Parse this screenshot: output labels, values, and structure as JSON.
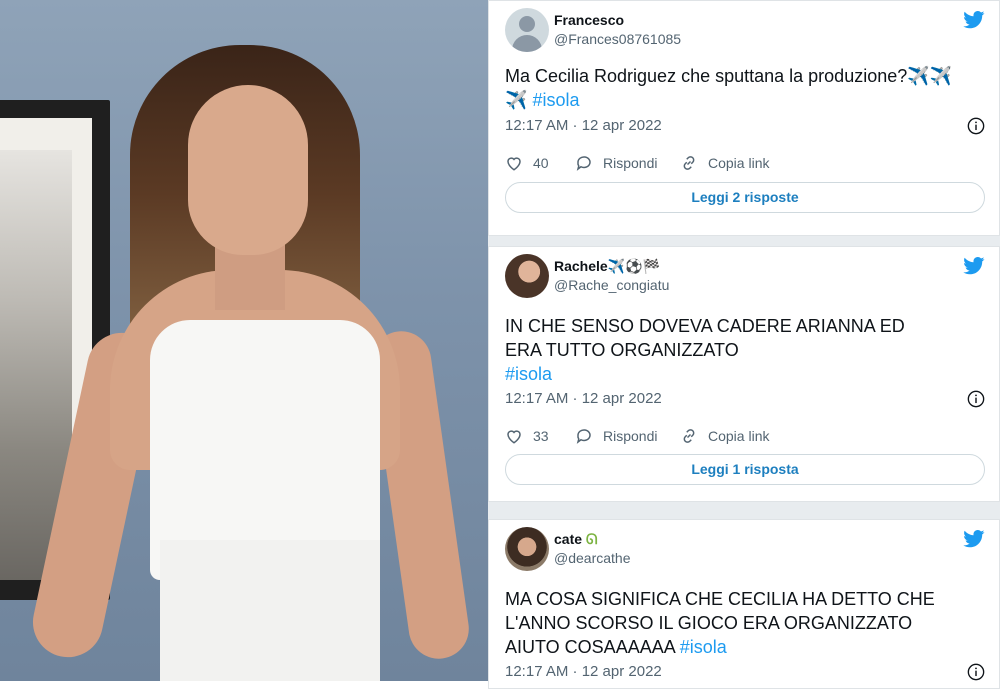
{
  "photo": {
    "description_icon": "photo"
  },
  "tweets": [
    {
      "name": "Francesco",
      "handle": "@Frances08761085",
      "text_main": "Ma Cecilia Rodriguez che sputtana la produzione?✈️✈️ ✈️",
      "text_hashtag": "#isola",
      "time": "12:17 AM · 12 apr 2022",
      "likes": "40",
      "reply_label": "Rispondi",
      "copy_label": "Copia link",
      "replies_button": "Leggi 2 risposte"
    },
    {
      "name": "Rachele✈️⚽️🏁",
      "handle": "@Rache_congiatu",
      "text_main": "IN CHE SENSO DOVEVA CADERE ARIANNA ED ERA TUTTO ORGANIZZATO",
      "text_hashtag": "#isola",
      "time": "12:17 AM · 12 apr 2022",
      "likes": "33",
      "reply_label": "Rispondi",
      "copy_label": "Copia link",
      "replies_button": "Leggi 1 risposta"
    },
    {
      "name": "cate",
      "name_emoji": "ᘏ",
      "handle": "@dearcathe",
      "text_main": "MA COSA SIGNIFICA CHE CECILIA HA DETTO CHE L'ANNO SCORSO IL GIOCO ERA ORGANIZZATO AIUTO COSAAAAAA",
      "text_hashtag": "#isola",
      "time": "12:17 AM · 12 apr 2022"
    }
  ],
  "colors": {
    "twitter_blue": "#1d9bf0",
    "text": "#0f1419",
    "muted": "#536471"
  }
}
